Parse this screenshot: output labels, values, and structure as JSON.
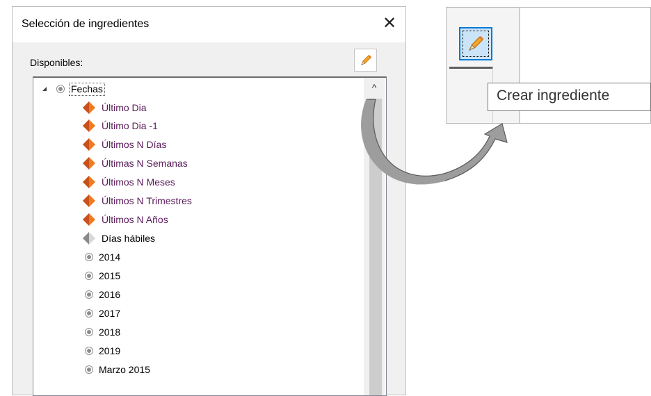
{
  "dialog": {
    "title": "Selección de ingredientes",
    "close_glyph": "✕",
    "available_label": "Disponibles:",
    "edit_icon": "pencil-icon"
  },
  "tree": {
    "root": {
      "label": "Fechas",
      "icon": "radio-icon",
      "expanded": true
    },
    "children": [
      {
        "label": "Último Dia",
        "icon": "orange-diamond-icon"
      },
      {
        "label": "Último Dia -1",
        "icon": "orange-diamond-icon"
      },
      {
        "label": "Últimos N Días",
        "icon": "orange-diamond-icon"
      },
      {
        "label": "Últimas N Semanas",
        "icon": "orange-diamond-icon"
      },
      {
        "label": "Últimos N Meses",
        "icon": "orange-diamond-icon"
      },
      {
        "label": "Últimos N Trimestres",
        "icon": "orange-diamond-icon"
      },
      {
        "label": "Últimos N Años",
        "icon": "orange-diamond-icon"
      },
      {
        "label": "Días hábiles",
        "icon": "gray-diamond-icon"
      },
      {
        "label": "2014",
        "icon": "radio-icon"
      },
      {
        "label": "2015",
        "icon": "radio-icon"
      },
      {
        "label": "2016",
        "icon": "radio-icon"
      },
      {
        "label": "2017",
        "icon": "radio-icon"
      },
      {
        "label": "2018",
        "icon": "radio-icon"
      },
      {
        "label": "2019",
        "icon": "radio-icon"
      },
      {
        "label": "Marzo 2015",
        "icon": "radio-icon"
      }
    ],
    "scroll_up_glyph": "^"
  },
  "zoom": {
    "tooltip": "Crear ingrediente",
    "button_icon": "pencil-icon"
  },
  "colors": {
    "accent": "#0078d7",
    "orange": "#f07a22",
    "purple_text": "#5a1a5a"
  }
}
